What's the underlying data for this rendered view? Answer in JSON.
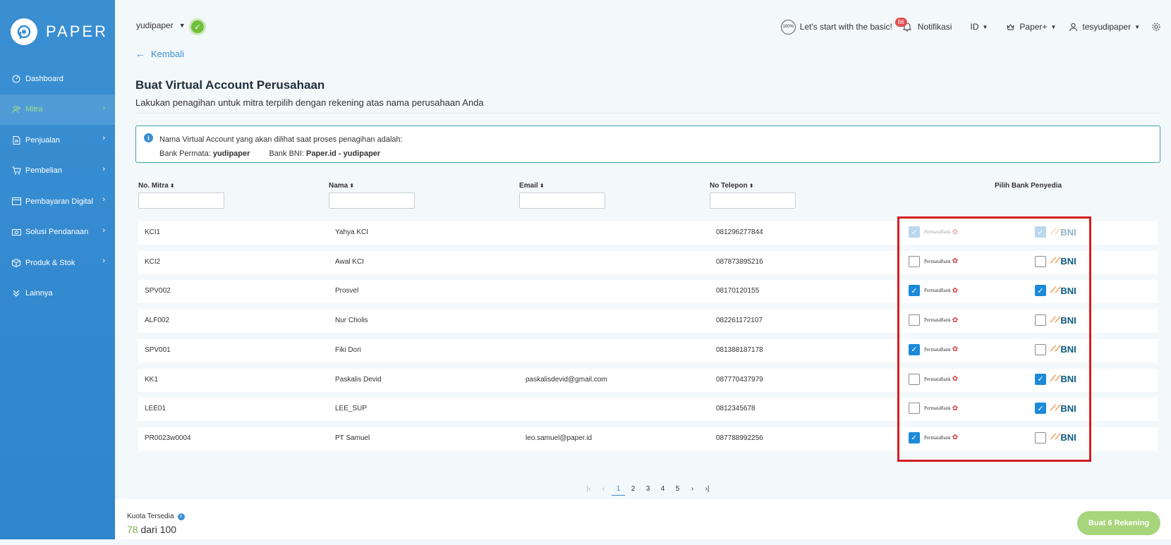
{
  "brand": {
    "name": "PAPER"
  },
  "sidebar": {
    "items": [
      {
        "label": "Dashboard",
        "icon": "dashboard-icon",
        "chevron": false,
        "active": false
      },
      {
        "label": "Mitra",
        "icon": "people-icon",
        "chevron": true,
        "active": true
      },
      {
        "label": "Penjualan",
        "icon": "document-icon",
        "chevron": true,
        "active": false
      },
      {
        "label": "Pembelian",
        "icon": "cart-icon",
        "chevron": true,
        "active": false
      },
      {
        "label": "Pembayaran Digital",
        "icon": "card-icon",
        "chevron": true,
        "active": false
      },
      {
        "label": "Solusi Pendanaan",
        "icon": "money-icon",
        "chevron": true,
        "active": false
      },
      {
        "label": "Produk & Stok",
        "icon": "box-icon",
        "chevron": true,
        "active": false
      },
      {
        "label": "Lainnya",
        "icon": "double-chevron-icon",
        "chevron": false,
        "active": false
      }
    ]
  },
  "header": {
    "company": "yudipaper",
    "basic_badge": "100%",
    "basic_label": "Let's start with the basic!",
    "notif_count": "86",
    "notif_label": "Notifikasi",
    "language": "ID",
    "plan": "Paper+",
    "user": "tesyudipaper"
  },
  "back_label": "Kembali",
  "page": {
    "title": "Buat Virtual Account Perusahaan",
    "subtitle": "Lakukan penagihan untuk mitra terpilih dengan rekening atas nama perusahaan Anda"
  },
  "info": {
    "line1": "Nama Virtual Account yang akan dilihat saat proses penagihan adalah:",
    "permata_prefix": "Bank Permata: ",
    "permata_name": "yudipaper",
    "bni_prefix": "Bank BNI: ",
    "bni_name": "Paper.id - yudipaper"
  },
  "table": {
    "headers": {
      "no": "No. Mitra",
      "nama": "Nama",
      "email": "Email",
      "tel": "No Telepon",
      "bank": "Pilih Bank Penyedia"
    },
    "bank_labels": {
      "permata": "PermataBank",
      "bni": "BNI"
    },
    "rows": [
      {
        "no": "KCI1",
        "nama": "Yahya KCI",
        "email": "",
        "tel": "081296277844",
        "permata": "disabled",
        "bni": "disabled"
      },
      {
        "no": "KCI2",
        "nama": "Awal KCI",
        "email": "",
        "tel": "087873895216",
        "permata": "unchecked",
        "bni": "unchecked"
      },
      {
        "no": "SPV002",
        "nama": "Prosvel",
        "email": "",
        "tel": "08170120155",
        "permata": "checked",
        "bni": "checked"
      },
      {
        "no": "ALF002",
        "nama": "Nur Cholis",
        "email": "",
        "tel": "082261172107",
        "permata": "unchecked",
        "bni": "unchecked"
      },
      {
        "no": "SPV001",
        "nama": "Fiki Dori",
        "email": "",
        "tel": "081388187178",
        "permata": "checked",
        "bni": "unchecked"
      },
      {
        "no": "KK1",
        "nama": "Paskalis Devid",
        "email": "paskalisdevid@gmail.com",
        "tel": "087770437979",
        "permata": "unchecked",
        "bni": "checked"
      },
      {
        "no": "LEE01",
        "nama": "LEE_SUP",
        "email": "",
        "tel": "0812345678",
        "permata": "unchecked",
        "bni": "checked"
      },
      {
        "no": "PR0023w0004",
        "nama": "PT Samuel",
        "email": "leo.samuel@paper.id",
        "tel": "087788992256",
        "permata": "checked",
        "bni": "unchecked"
      }
    ]
  },
  "pagination": {
    "pages": [
      "1",
      "2",
      "3",
      "4",
      "5"
    ],
    "current": "1"
  },
  "footer": {
    "quota_label": "Kuota Tersedia",
    "quota_used": "78",
    "quota_rest": " dari 100",
    "create_button": "Buat 6 Rekening"
  },
  "colors": {
    "sidebar": "#3a8fd2",
    "accent": "#1c8ad8",
    "highlight": "#d41f1f",
    "success": "#7ab648"
  }
}
